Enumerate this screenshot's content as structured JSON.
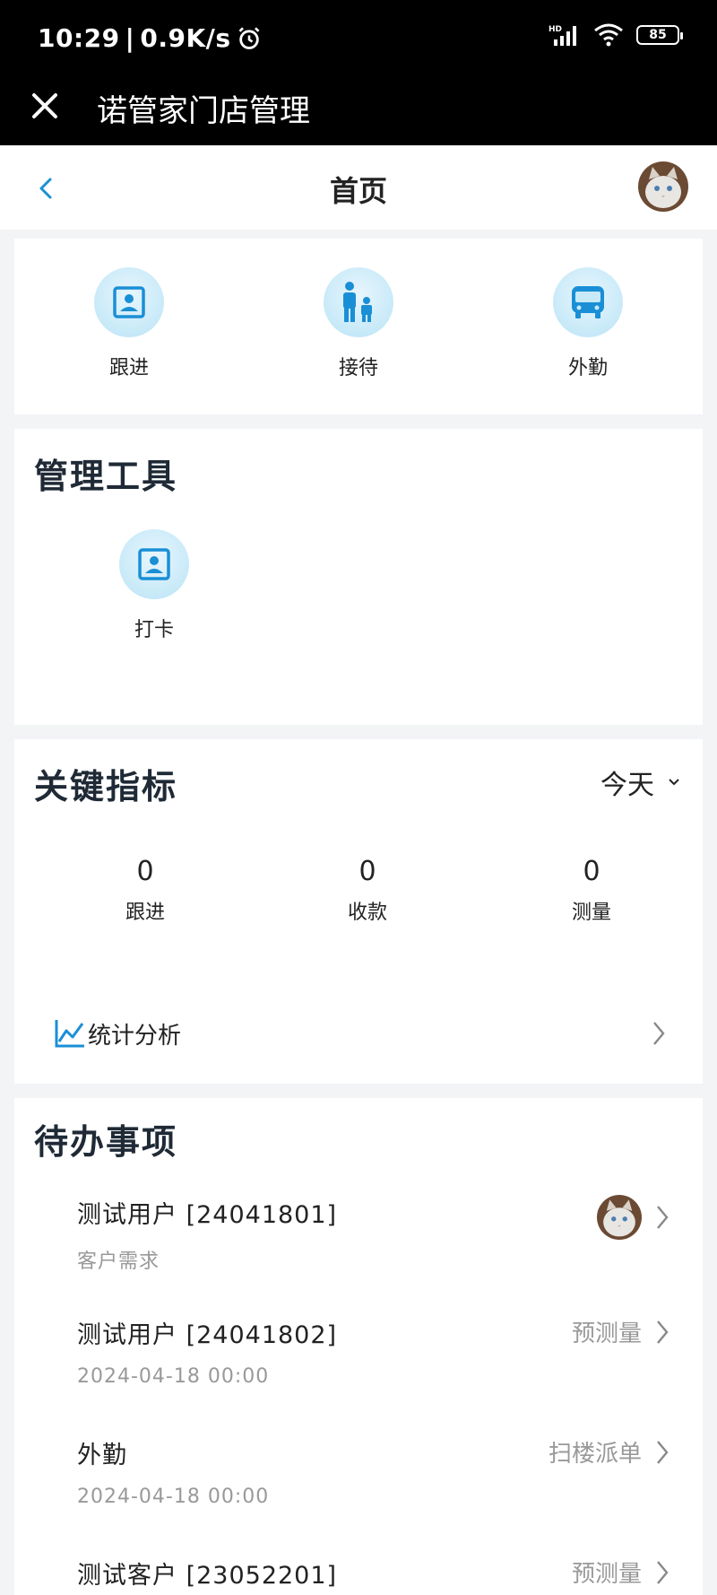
{
  "status": {
    "time": "10:29",
    "speed": "0.9K/s",
    "network": "HD",
    "battery": "85"
  },
  "app": {
    "title": "诺管家门店管理",
    "close_icon": "close-icon"
  },
  "nav": {
    "title": "首页",
    "back_icon": "chevron-left-icon",
    "avatar": "cat-avatar"
  },
  "quick_actions": [
    {
      "label": "跟进",
      "icon": "contact-card-icon"
    },
    {
      "label": "接待",
      "icon": "people-icon"
    },
    {
      "label": "外勤",
      "icon": "bus-icon"
    }
  ],
  "tools": {
    "title": "管理工具",
    "items": [
      {
        "label": "打卡",
        "icon": "contact-card-icon"
      }
    ]
  },
  "metrics": {
    "title": "关键指标",
    "range": "今天",
    "items": [
      {
        "value": "0",
        "label": "跟进"
      },
      {
        "value": "0",
        "label": "收款"
      },
      {
        "value": "0",
        "label": "测量"
      }
    ],
    "stats_label": "统计分析"
  },
  "todo": {
    "title": "待办事项",
    "items": [
      {
        "title": "测试用户 [24041801]",
        "sub": "客户需求",
        "tag": ""
      },
      {
        "title": "测试用户 [24041802]",
        "sub": "2024-04-18 00:00",
        "tag": "预测量"
      },
      {
        "title": "外勤",
        "sub": "2024-04-18 00:00",
        "tag": "扫楼派单"
      },
      {
        "title": "测试客户 [23052201]",
        "sub": "",
        "tag": "预测量"
      }
    ]
  },
  "colors": {
    "accent": "#1a8fd6",
    "icon_bg": "#c7e9f8",
    "muted": "#999999"
  }
}
